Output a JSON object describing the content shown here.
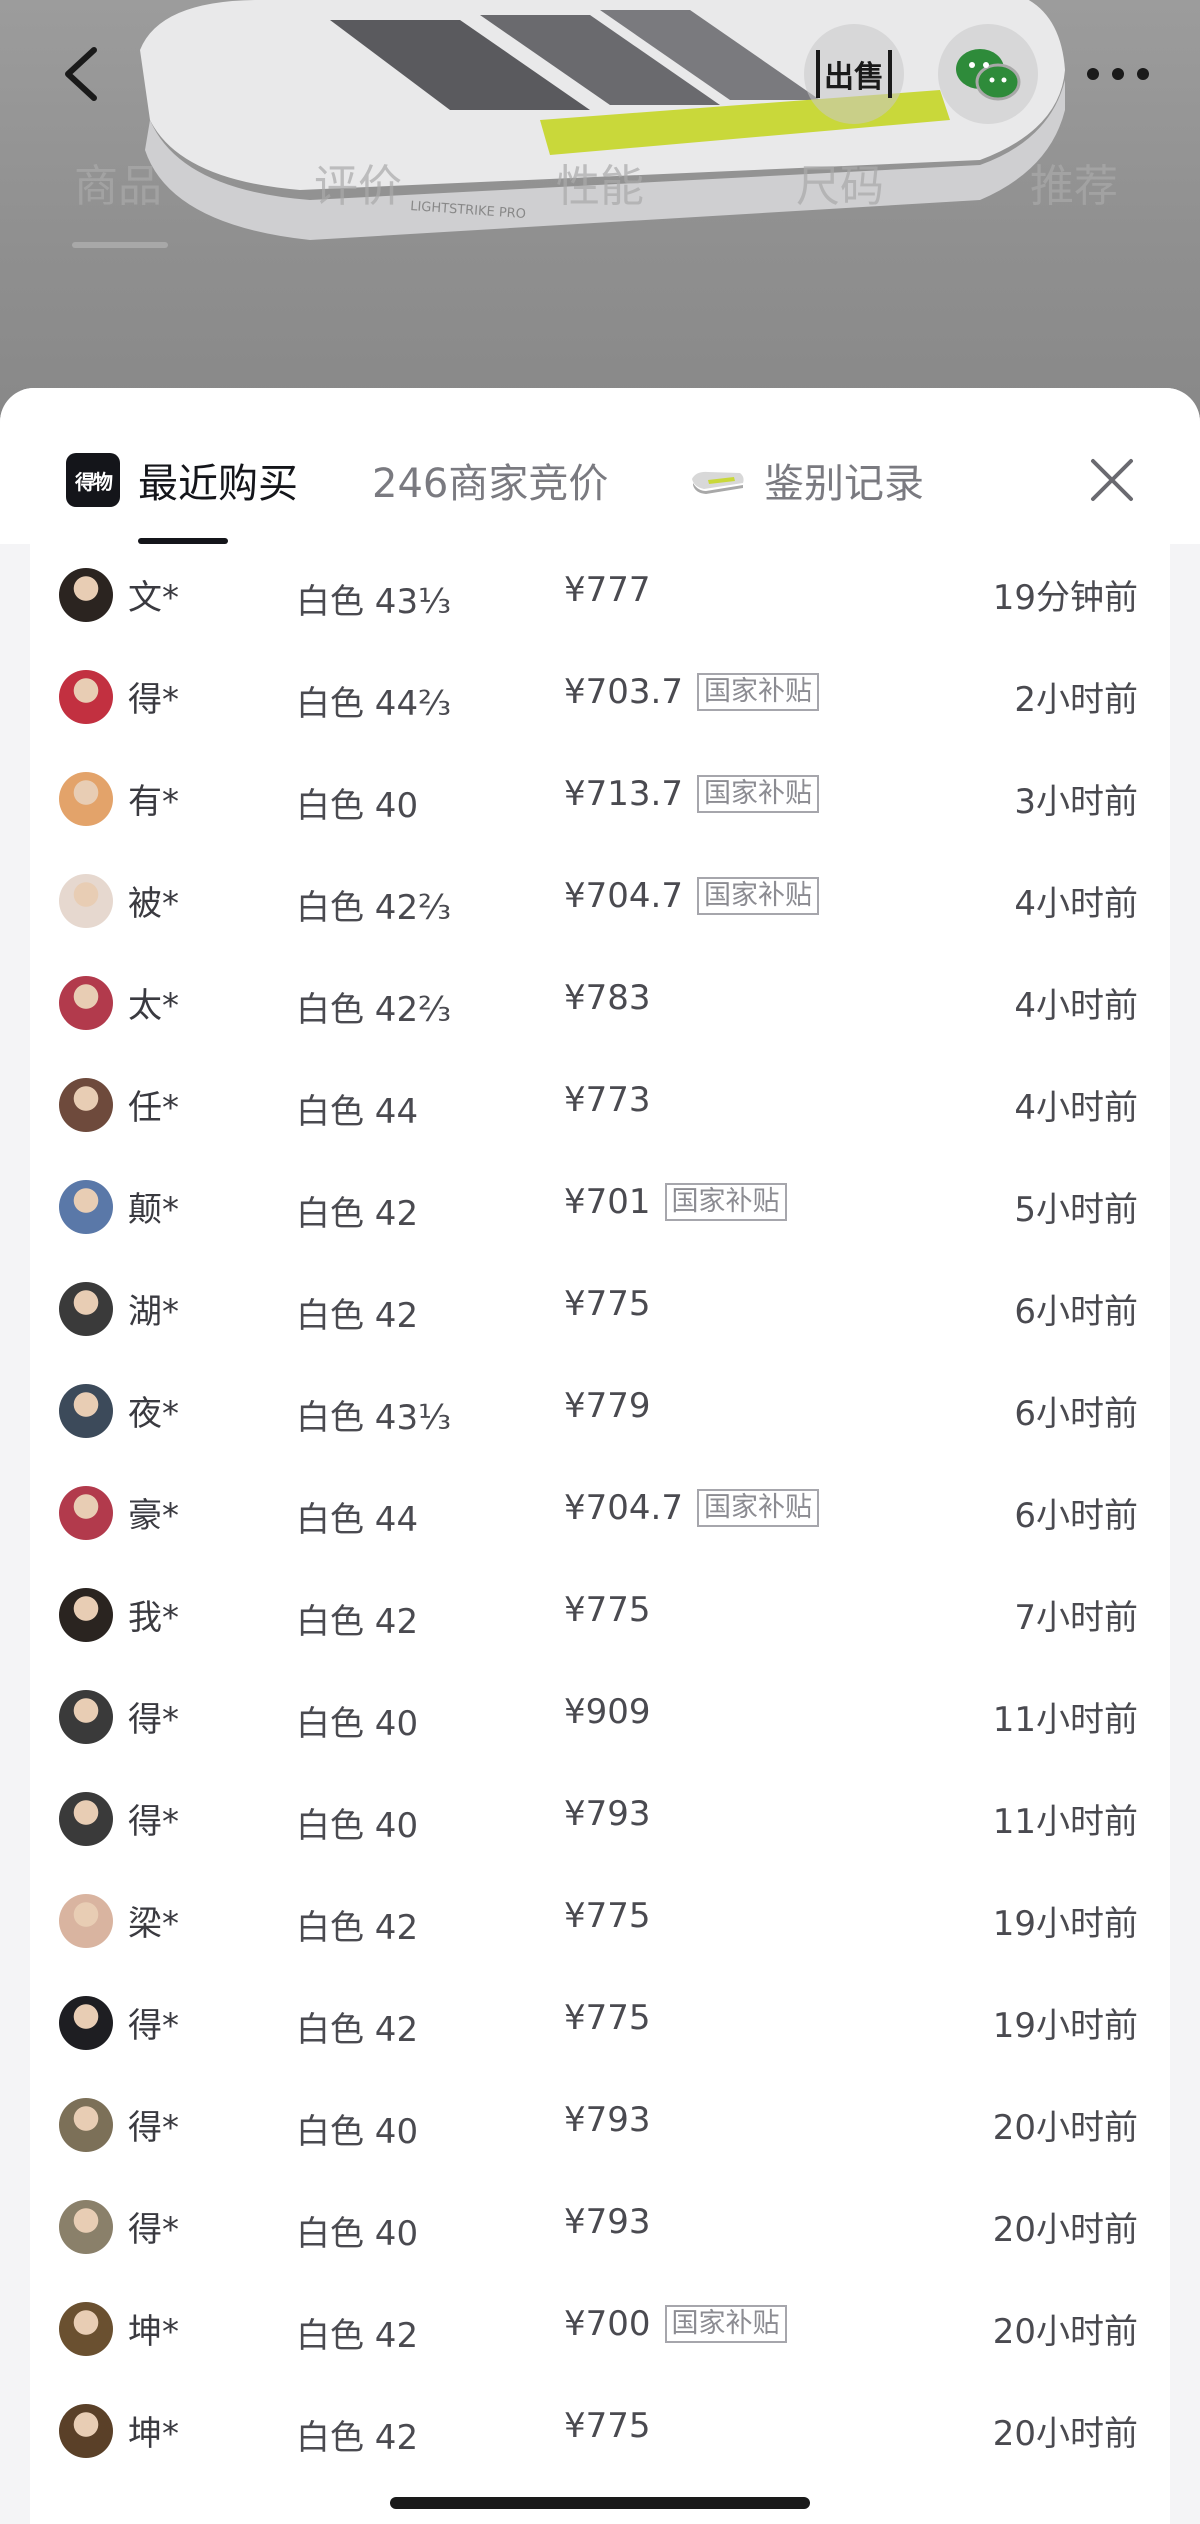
{
  "background_page": {
    "tabs": [
      "商品",
      "评价",
      "性能",
      "尺码",
      "推荐"
    ],
    "sell_label": "出售",
    "shoe_print": "LIGHTSTRIKE PRO"
  },
  "sheet": {
    "tabs": {
      "recent": "最近购买",
      "bids": "246商家竞价",
      "auth": "鉴别记录"
    },
    "app_logo": "得物",
    "close_label": "×"
  },
  "purchases": [
    {
      "user": "文*",
      "spec": "白色 43⅓",
      "price": "¥777",
      "subsidy": "",
      "time": "19分钟前",
      "avatar_color": "#2b2420"
    },
    {
      "user": "得*",
      "spec": "白色 44⅔",
      "price": "¥703.7",
      "subsidy": "国家补贴",
      "time": "2小时前",
      "avatar_color": "#c23040"
    },
    {
      "user": "有*",
      "spec": "白色 40",
      "price": "¥713.7",
      "subsidy": "国家补贴",
      "time": "3小时前",
      "avatar_color": "#e3a36a"
    },
    {
      "user": "被*",
      "spec": "白色 42⅔",
      "price": "¥704.7",
      "subsidy": "国家补贴",
      "time": "4小时前",
      "avatar_color": "#e6d8cf"
    },
    {
      "user": "太*",
      "spec": "白色 42⅔",
      "price": "¥783",
      "subsidy": "",
      "time": "4小时前",
      "avatar_color": "#b23a4c"
    },
    {
      "user": "任*",
      "spec": "白色 44",
      "price": "¥773",
      "subsidy": "",
      "time": "4小时前",
      "avatar_color": "#6e4a3c"
    },
    {
      "user": "颠*",
      "spec": "白色 42",
      "price": "¥701",
      "subsidy": "国家补贴",
      "time": "5小时前",
      "avatar_color": "#5a78a8"
    },
    {
      "user": "湖*",
      "spec": "白色 42",
      "price": "¥775",
      "subsidy": "",
      "time": "6小时前",
      "avatar_color": "#3a3a3a"
    },
    {
      "user": "夜*",
      "spec": "白色 43⅓",
      "price": "¥779",
      "subsidy": "",
      "time": "6小时前",
      "avatar_color": "#3c4a5a"
    },
    {
      "user": "豪*",
      "spec": "白色 44",
      "price": "¥704.7",
      "subsidy": "国家补贴",
      "time": "6小时前",
      "avatar_color": "#b23a4c"
    },
    {
      "user": "我*",
      "spec": "白色 42",
      "price": "¥775",
      "subsidy": "",
      "time": "7小时前",
      "avatar_color": "#2a2420"
    },
    {
      "user": "得*",
      "spec": "白色 40",
      "price": "¥909",
      "subsidy": "",
      "time": "11小时前",
      "avatar_color": "#3a3a3a"
    },
    {
      "user": "得*",
      "spec": "白色 40",
      "price": "¥793",
      "subsidy": "",
      "time": "11小时前",
      "avatar_color": "#3a3a3a"
    },
    {
      "user": "梁*",
      "spec": "白色 42",
      "price": "¥775",
      "subsidy": "",
      "time": "19小时前",
      "avatar_color": "#d9b4a0"
    },
    {
      "user": "得*",
      "spec": "白色 42",
      "price": "¥775",
      "subsidy": "",
      "time": "19小时前",
      "avatar_color": "#1e1e22"
    },
    {
      "user": "得*",
      "spec": "白色 40",
      "price": "¥793",
      "subsidy": "",
      "time": "20小时前",
      "avatar_color": "#7c7058"
    },
    {
      "user": "得*",
      "spec": "白色 40",
      "price": "¥793",
      "subsidy": "",
      "time": "20小时前",
      "avatar_color": "#8a806a"
    },
    {
      "user": "坤*",
      "spec": "白色 42",
      "price": "¥700",
      "subsidy": "国家补贴",
      "time": "20小时前",
      "avatar_color": "#6a5030"
    },
    {
      "user": "坤*",
      "spec": "白色 42",
      "price": "¥775",
      "subsidy": "",
      "time": "20小时前",
      "avatar_color": "#5a4028"
    }
  ]
}
